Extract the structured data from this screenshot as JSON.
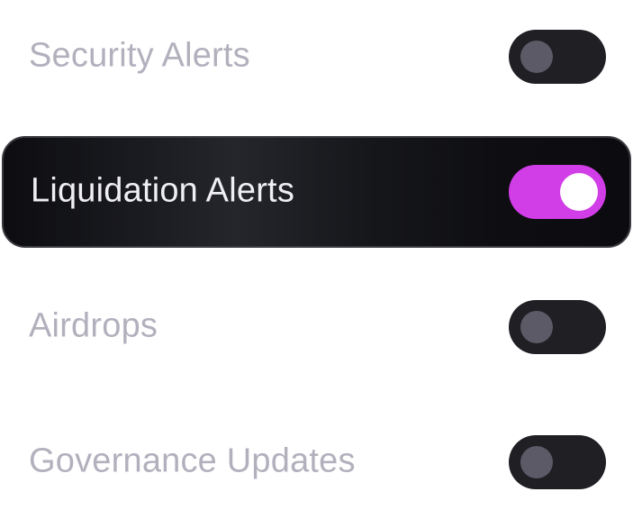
{
  "notifications": {
    "items": [
      {
        "label": "Security Alerts",
        "enabled": false,
        "selected": false
      },
      {
        "label": "Liquidation Alerts",
        "enabled": true,
        "selected": true
      },
      {
        "label": "Airdrops",
        "enabled": false,
        "selected": false
      },
      {
        "label": "Governance Updates",
        "enabled": false,
        "selected": false
      }
    ]
  },
  "colors": {
    "toggle_on": "#d13de7",
    "toggle_off": "#1f1f24",
    "knob_off": "#5d5a68",
    "knob_on": "#ffffff",
    "label_inactive": "#b3b0bd",
    "label_active": "#efeef3",
    "row_active_bg": "#16171b"
  }
}
